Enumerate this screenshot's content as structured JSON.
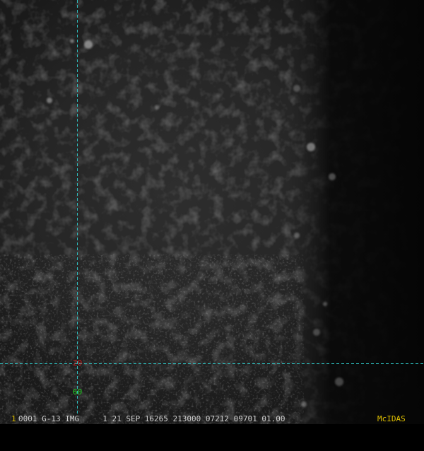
{
  "image": {
    "kind": "satellite-visible-imagery",
    "description_colors": {
      "background": "#000000",
      "cloud_dark": "#2a2a2a",
      "cloud_bright": "#8a8a8a"
    }
  },
  "overlay": {
    "grid_color": "#2ec4c4",
    "latitude_label": "20",
    "latitude_color": "#cc2222",
    "longitude_label": "60",
    "longitude_color": "#22cc22"
  },
  "status_bar": {
    "frame_number": "1",
    "frame_color": "#e0c000",
    "text": "0001 G-13 IMG     1 21 SEP 16265 213000 07212 09701 01.00",
    "text_color": "#d0d0d0",
    "brand": "McIDAS",
    "brand_color": "#e0c000"
  }
}
